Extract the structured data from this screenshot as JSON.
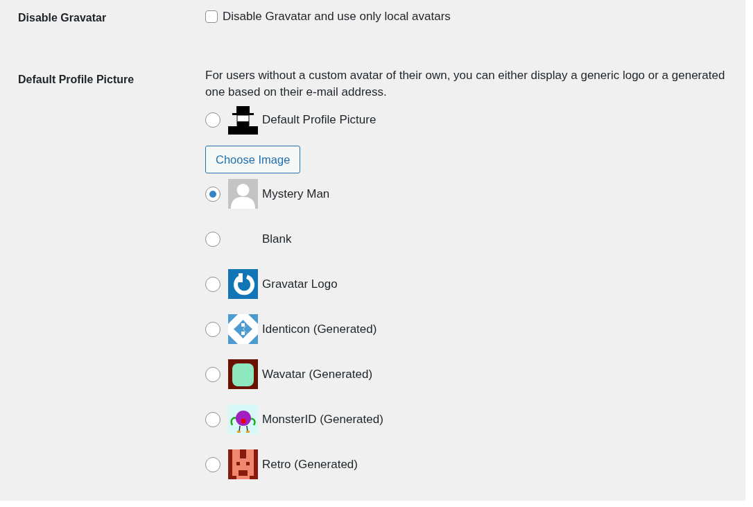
{
  "settings": [
    {
      "label": "Disable Gravatar",
      "checkbox": {
        "label": "Disable Gravatar and use only local avatars",
        "checked": false
      }
    },
    {
      "label": "Default Profile Picture",
      "description": "For users without a custom avatar of their own, you can either display a generic logo or a generated one based on their e-mail address.",
      "options": [
        {
          "kind": "custom",
          "label": "Default Profile Picture",
          "selected": false,
          "button": "Choose Image"
        },
        {
          "kind": "mystery",
          "label": "Mystery Man",
          "selected": true
        },
        {
          "kind": "blank",
          "label": "Blank",
          "selected": false
        },
        {
          "kind": "logo",
          "label": "Gravatar Logo",
          "selected": false
        },
        {
          "kind": "identicon",
          "label": "Identicon (Generated)",
          "selected": false
        },
        {
          "kind": "wavatar",
          "label": "Wavatar (Generated)",
          "selected": false
        },
        {
          "kind": "monsterid",
          "label": "MonsterID (Generated)",
          "selected": false
        },
        {
          "kind": "retro",
          "label": "Retro (Generated)",
          "selected": false
        }
      ]
    }
  ]
}
